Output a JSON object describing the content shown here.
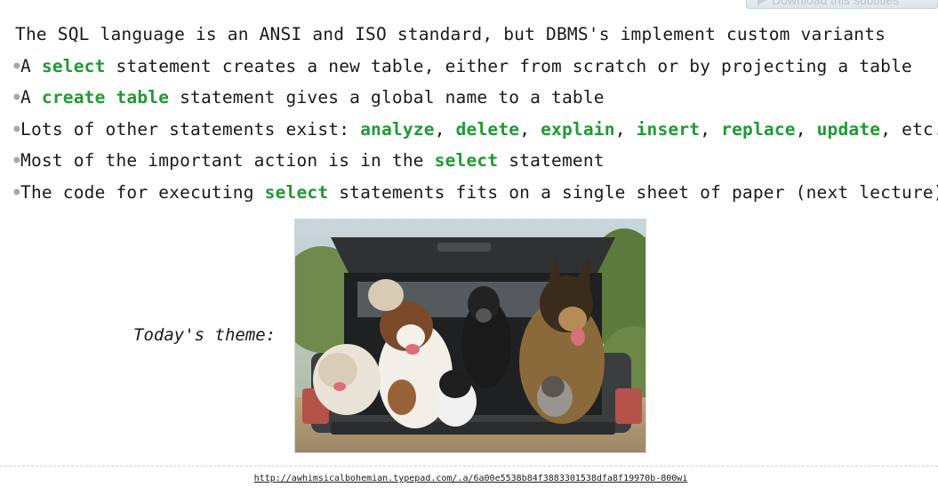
{
  "subtitles_button": {
    "label": "Download this subtitles"
  },
  "heading": "The SQL language is an ANSI and ISO standard, but DBMS's implement custom variants",
  "bullets": [
    {
      "pre": "A ",
      "kw": "select",
      "post": " statement creates a new table, either from scratch or by projecting a table"
    },
    {
      "pre": "A ",
      "kw": "create table",
      "post": " statement gives a global name to a table"
    },
    {
      "pre": "Lots of other statements exist: ",
      "keywords": [
        "analyze",
        "delete",
        "explain",
        "insert",
        "replace",
        "update"
      ],
      "sep": ", ",
      "post": ", etc."
    },
    {
      "pre": "Most of the important action is in the ",
      "kw": "select",
      "post": " statement"
    },
    {
      "pre": "The code for executing ",
      "kw": "select",
      "post": " statements fits on a single sheet of paper (next lecture)"
    }
  ],
  "theme_label": "Today's theme:",
  "image": {
    "subject": "dogs-in-truck-photo"
  },
  "source_url": "http://awhimsicalbohemian.typepad.com/.a/6a00e5538b84f3883301538dfa8f19970b-800wi",
  "colors": {
    "keyword": "#1f9a32",
    "bullet": "#a7a7a7",
    "text": "#1a1a1a"
  }
}
